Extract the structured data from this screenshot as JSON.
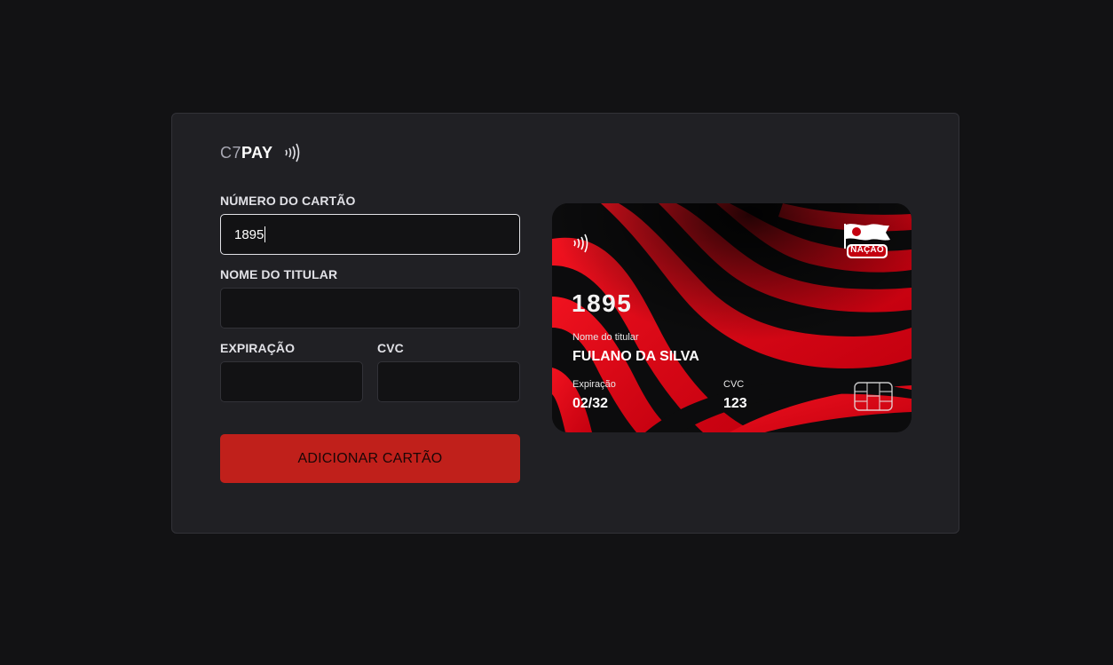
{
  "brand": {
    "prefix": "C7",
    "suffix": "PAY"
  },
  "form": {
    "card_number": {
      "label": "NÚMERO DO CARTÃO",
      "value": "1895"
    },
    "holder_name": {
      "label": "NOME DO TITULAR",
      "value": ""
    },
    "expiration": {
      "label": "EXPIRAÇÃO",
      "value": ""
    },
    "cvc": {
      "label": "CVC",
      "value": ""
    },
    "submit_label": "ADICIONAR CARTÃO"
  },
  "card": {
    "number": "1895",
    "holder_caption": "Nome do titular",
    "holder_name": "FULANO DA SILVA",
    "expiration_caption": "Expiração",
    "expiration": "02/32",
    "cvc_caption": "CVC",
    "cvc": "123",
    "logo_text": "NAÇÃO"
  },
  "colors": {
    "background": "#121214",
    "panel": "#202024",
    "button": "#c0201b",
    "card_red": "#e3081c",
    "card_black": "#0c0c0d"
  },
  "icons": {
    "brand_contactless": "contactless-icon",
    "card_contactless": "contactless-icon",
    "card_chip": "chip-icon",
    "card_logo": "flag-logo"
  }
}
